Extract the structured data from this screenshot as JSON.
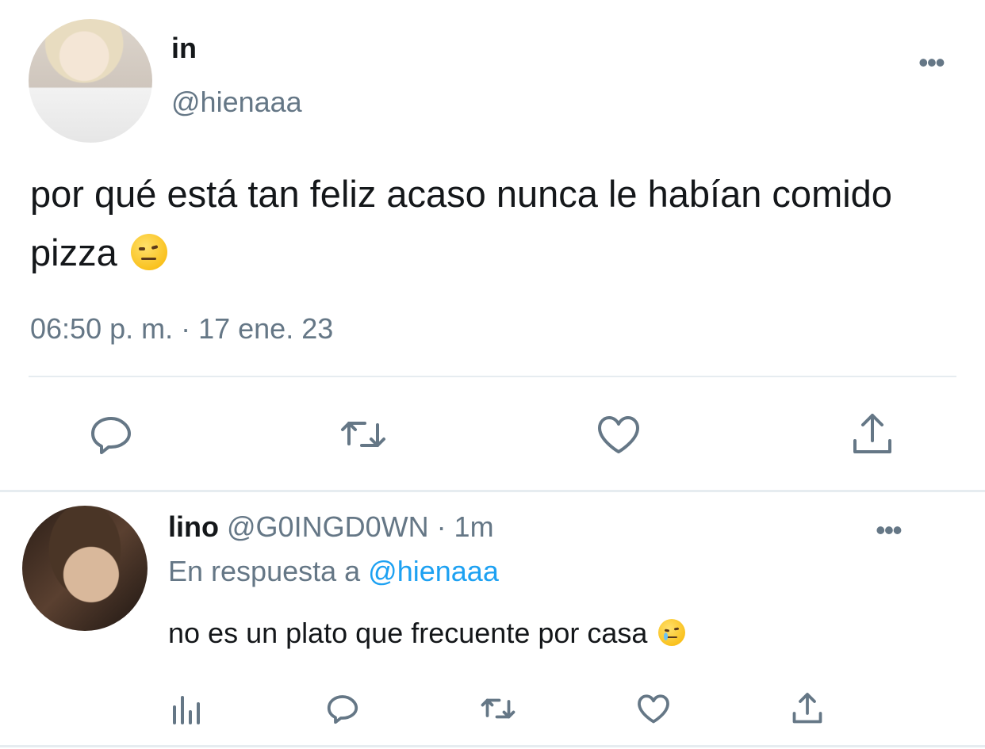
{
  "main_tweet": {
    "author_name": "in",
    "author_handle": "@hienaaa",
    "text": "por qué está tan feliz acaso nunca le habían comido pizza",
    "emoji": "raised-eyebrow-face",
    "timestamp": "06:50 p. m. · 17 ene. 23",
    "actions": [
      "reply-icon",
      "retweet-icon",
      "like-icon",
      "share-icon"
    ]
  },
  "reply": {
    "author_name": "lino",
    "author_handle": "@G0INGD0WN · 1m",
    "reply_prefix": "En respuesta a",
    "reply_mention": "@hienaaa",
    "text": "no es un plato que frecuente por casa",
    "emoji": "crying-face",
    "actions": [
      "analytics-icon",
      "reply-icon",
      "retweet-icon",
      "like-icon",
      "share-icon"
    ]
  },
  "colors": {
    "text": "#14171a",
    "secondary": "#657786",
    "link": "#1da1f2",
    "divider": "#e6ecf0"
  }
}
